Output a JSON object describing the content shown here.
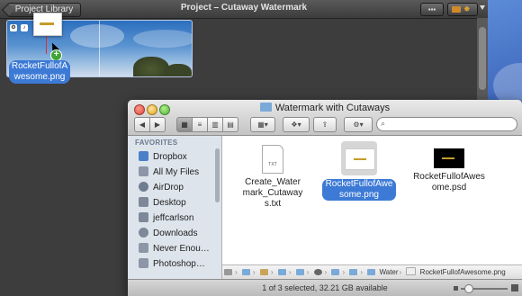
{
  "imovie": {
    "library_button": "Project Library",
    "title": "Project – Cutaway Watermark",
    "drag_label": "RocketFullofAwesome.png",
    "add_badge": "+"
  },
  "finder": {
    "title": "Watermark with Cutaways",
    "sidebar": {
      "header": "FAVORITES",
      "items": [
        {
          "label": "Dropbox",
          "icon": "dropbox-icon"
        },
        {
          "label": "All My Files",
          "icon": "all-files-icon"
        },
        {
          "label": "AirDrop",
          "icon": "airdrop-icon"
        },
        {
          "label": "Desktop",
          "icon": "desktop-icon"
        },
        {
          "label": "jeffcarlson",
          "icon": "home-icon"
        },
        {
          "label": "Downloads",
          "icon": "downloads-icon"
        },
        {
          "label": "Never Enou…",
          "icon": "folder-icon"
        },
        {
          "label": "Photoshop…",
          "icon": "folder-icon"
        }
      ]
    },
    "files": [
      {
        "name": "Create_Watermark_Cutaways.txt",
        "icon_text": "TXT"
      },
      {
        "name": "RocketFullofAwesome.png",
        "selected": true
      },
      {
        "name": "RocketFullofAwesome.psd"
      }
    ],
    "path": {
      "folder": "Water",
      "file": "RocketFullofAwesome.png"
    },
    "status": "1 of 3 selected, 32.21 GB available",
    "colors": {
      "selection": "#3d7ad6",
      "sidebar": "#dde4ec"
    }
  }
}
